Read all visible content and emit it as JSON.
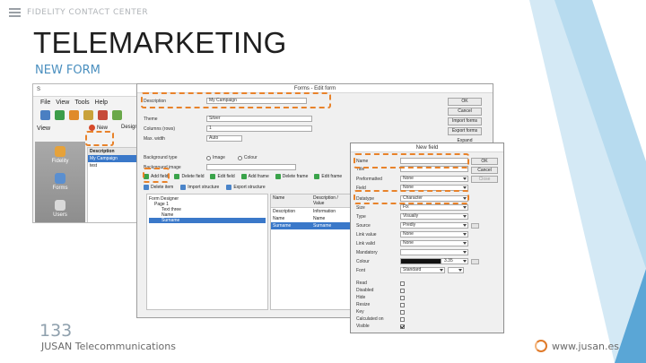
{
  "header": {
    "menu_icon": "hamburger-icon",
    "section": "FIDELITY CONTACT CENTER",
    "title": "TELEMARKETING",
    "subtitle": "NEW FORM"
  },
  "footer": {
    "slide_number": "133",
    "company": "JUSAN Telecommunications",
    "website": "www.jusan.es",
    "logo_icon": "jusan-logo-icon"
  },
  "colors": {
    "accent": "#4a8fbf",
    "highlight": "#e8822a",
    "decor_light": "#d4e9f5",
    "decor_dark": "#5aa6d6"
  },
  "main_window": {
    "title": "S",
    "menus": [
      "File",
      "View",
      "Tools",
      "Help"
    ],
    "view_label": "View",
    "new_button": "New",
    "design_button": "Design",
    "sidebar": [
      "Fidelity",
      "Forms",
      "Users"
    ],
    "list_header": "Description",
    "list_rows": [
      "My Campaign",
      "test"
    ]
  },
  "edit_window": {
    "title": "Forms - Edit form",
    "fields": [
      {
        "label": "Description",
        "value": "My Campaign"
      },
      {
        "label": "Theme",
        "value": "Silver"
      },
      {
        "label": "Columns (rows)",
        "value": "1"
      },
      {
        "label": "Max. width",
        "value": "Auto"
      }
    ],
    "background_type_label": "Background type",
    "background_options": [
      "Image",
      "Colour"
    ],
    "background_image_label": "Background image",
    "buttons": [
      "OK",
      "Cancel",
      "Import forms",
      "Export forms",
      "Expand"
    ],
    "tools_row": [
      "Add field",
      "Delete field",
      "Edit field",
      "Add frame",
      "Delete frame",
      "Edit frame"
    ],
    "tools_row2": [
      "Delete item",
      "Import structure",
      "Export structure"
    ],
    "tree": [
      "Form Designer",
      "Page 1",
      "Text three",
      "Name",
      "Surname"
    ],
    "grid_headers": [
      "Name",
      "Description / Value"
    ],
    "grid_rows": [
      [
        "Description",
        "Information"
      ],
      [
        "Name",
        "Name"
      ],
      [
        "Surname",
        "Surname"
      ]
    ]
  },
  "new_field_window": {
    "title": "New field",
    "rows": [
      {
        "label": "Name",
        "value": "",
        "type": "input"
      },
      {
        "label": "Title",
        "value": "",
        "type": "input"
      },
      {
        "label": "Preformatted",
        "value": "None",
        "type": "select"
      },
      {
        "label": "Field",
        "value": "None",
        "type": "select"
      },
      {
        "label": "Datatype",
        "value": "Character",
        "type": "select"
      },
      {
        "label": "Size",
        "value": "Fix",
        "type": "select"
      },
      {
        "label": "Type",
        "value": "Visually",
        "type": "select"
      },
      {
        "label": "Source",
        "value": "Predly",
        "type": "select"
      },
      {
        "label": "Link value",
        "value": "None",
        "type": "select"
      },
      {
        "label": "Link valid",
        "value": "None",
        "type": "select"
      },
      {
        "label": "Mandatory",
        "value": "",
        "type": "select"
      },
      {
        "label": "Colour",
        "value": "3.35",
        "type": "select"
      },
      {
        "label": "Font",
        "value": "Standard",
        "type": "select"
      }
    ],
    "checks": [
      {
        "label": "Read",
        "checked": false
      },
      {
        "label": "Disabled",
        "checked": false
      },
      {
        "label": "Hide",
        "checked": false
      },
      {
        "label": "Resize",
        "checked": false
      },
      {
        "label": "Key",
        "checked": false
      },
      {
        "label": "Calculated on",
        "checked": false
      },
      {
        "label": "Visible",
        "checked": true
      }
    ],
    "buttons": [
      "OK",
      "Cancel",
      "Close"
    ]
  }
}
